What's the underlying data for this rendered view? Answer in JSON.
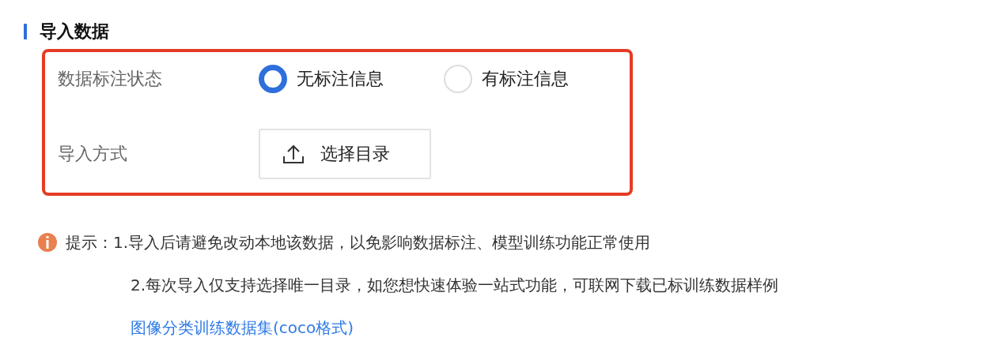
{
  "section": {
    "title": "导入数据"
  },
  "fields": [
    {
      "kind": "radio",
      "label": "数据标注状态",
      "options": [
        {
          "label": "无标注信息",
          "selected": true
        },
        {
          "label": "有标注信息",
          "selected": false
        }
      ]
    },
    {
      "kind": "upload",
      "label": "导入方式",
      "button": "选择目录"
    }
  ],
  "hint": {
    "prefix": "提示：",
    "lines": [
      "1.导入后请避免改动本地该数据，以免影响数据标注、模型训练功能正常使用",
      "2.每次导入仅支持选择唯一目录，如您想快速体验一站式功能，可联网下载已标训练数据样例"
    ],
    "link": "图像分类训练数据集(coco格式)"
  }
}
